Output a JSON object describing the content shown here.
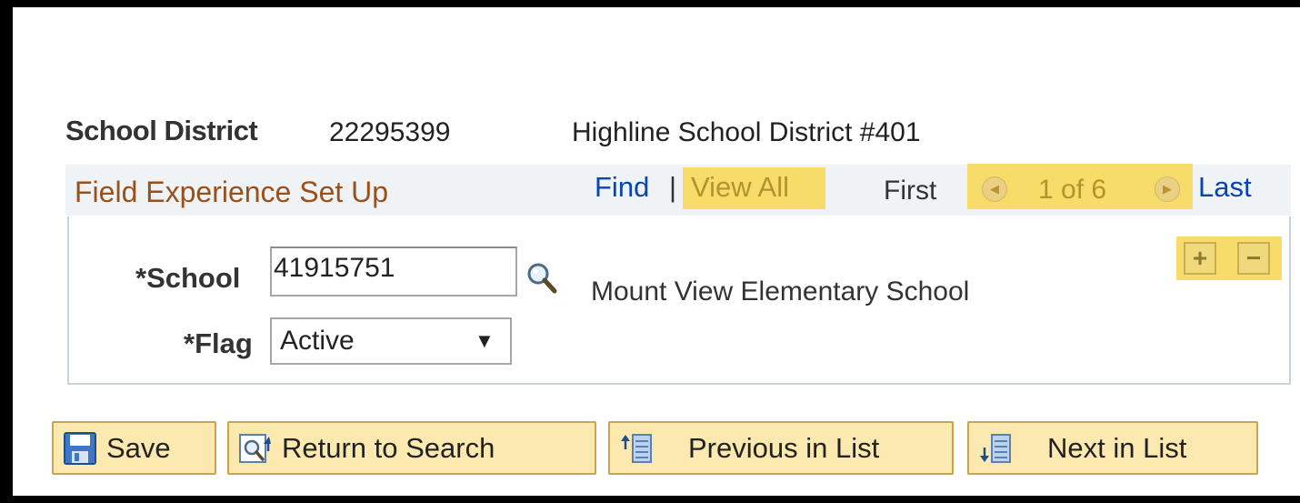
{
  "district": {
    "label": "School District",
    "id": "22295399",
    "name": "Highline School District #401"
  },
  "section": {
    "title": "Field Experience Set Up",
    "find_label": "Find",
    "separator": "|",
    "view_all_label": "View All",
    "first_label": "First",
    "page_count": "1 of 6",
    "last_label": "Last"
  },
  "form": {
    "school_label": "*School",
    "school_value": "41915751",
    "school_name": "Mount View Elementary School",
    "flag_label": "*Flag",
    "flag_value": "Active",
    "add_row_symbol": "+",
    "delete_row_symbol": "−"
  },
  "toolbar": {
    "save_label": "Save",
    "return_label": "Return to Search",
    "previous_label": "Previous in List",
    "next_label": "Next in List"
  },
  "colors": {
    "highlight": "#f7dc6a",
    "link": "#0645b4",
    "section_title": "#99501b",
    "button_bg": "#fbe9b0"
  },
  "icons": {
    "prev_page": "arrow-left-circle-icon",
    "next_page": "arrow-right-circle-icon",
    "lookup": "magnifier-icon",
    "save": "floppy-disk-icon",
    "return": "return-search-icon",
    "previous": "list-up-icon",
    "next": "list-down-icon"
  }
}
